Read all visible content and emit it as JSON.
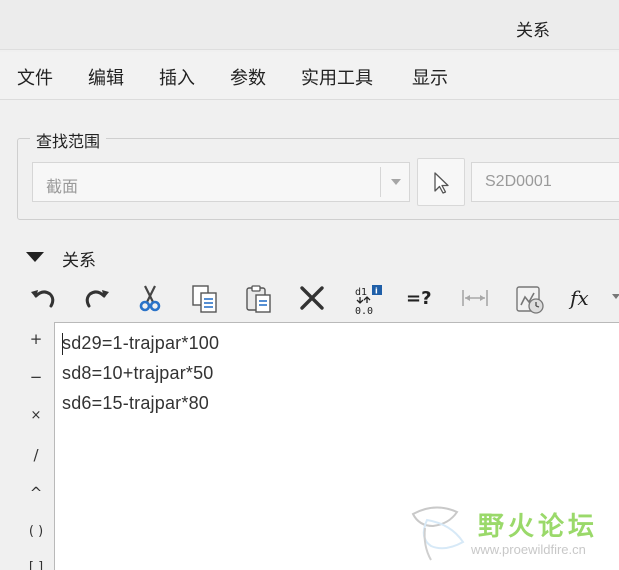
{
  "window": {
    "title": "关系"
  },
  "menu": [
    "文件",
    "编辑",
    "插入",
    "参数",
    "实用工具",
    "显示"
  ],
  "lookup": {
    "group_label": "查找范围",
    "scope_value": "截面",
    "name_value": "S2D0001"
  },
  "relations": {
    "section_label": "关系",
    "lines": [
      "sd29=1-trajpar*100",
      "sd8=10+trajpar*50",
      "sd6=15-trajpar*80"
    ]
  },
  "side_keys": [
    "+",
    "−",
    "×",
    "/",
    "^",
    "( )",
    "[ ]"
  ],
  "toolbar": {
    "units_icon_text": "d1",
    "units_icon_sub": "0.0",
    "evaluate_label": "=?",
    "fx_label": "fx"
  },
  "watermark": {
    "text": "野火论坛",
    "url": "www.proewildfire.cn"
  },
  "colors": {
    "watermark_green": "#9ad96a",
    "info_blue": "#1f5fa8"
  }
}
